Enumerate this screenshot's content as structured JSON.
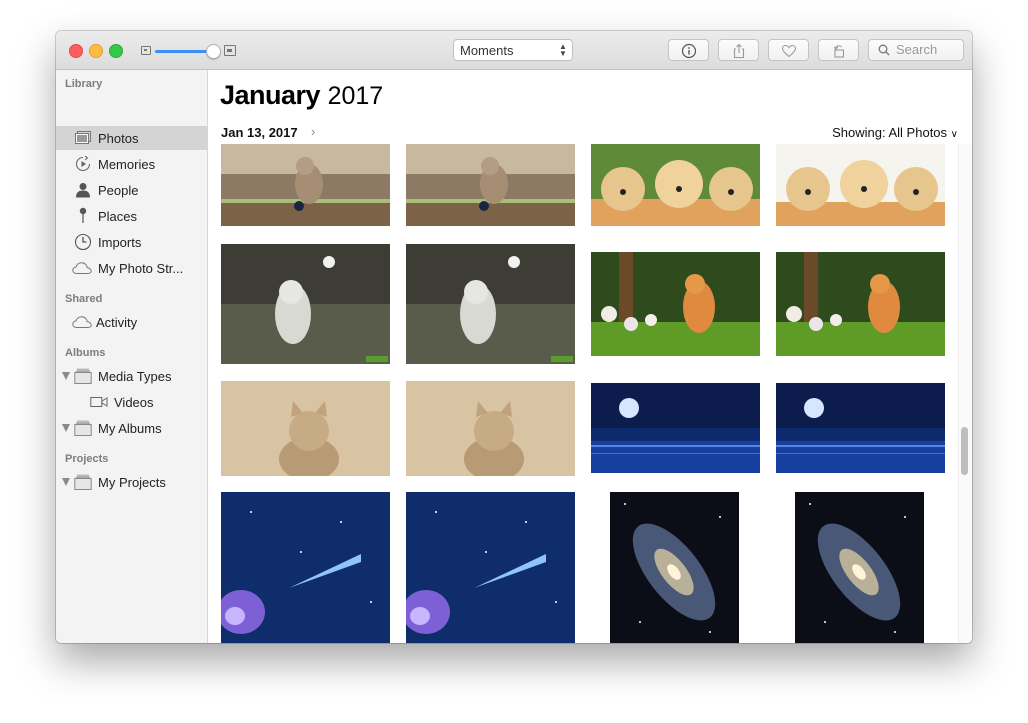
{
  "toolbar": {
    "view_select": "Moments",
    "search_placeholder": "Search"
  },
  "sidebar": {
    "sections": [
      {
        "title": "Library"
      },
      {
        "title": "Shared"
      },
      {
        "title": "Albums"
      },
      {
        "title": "Projects"
      }
    ],
    "items": [
      {
        "label": "Photos",
        "icon": "photos-icon",
        "selected": true
      },
      {
        "label": "Memories",
        "icon": "memories-icon"
      },
      {
        "label": "People",
        "icon": "people-icon"
      },
      {
        "label": "Places",
        "icon": "places-pin-icon"
      },
      {
        "label": "Imports",
        "icon": "imports-clock-icon"
      },
      {
        "label": "My Photo Str...",
        "icon": "cloud-icon"
      },
      {
        "label": "Activity",
        "icon": "cloud-icon"
      },
      {
        "label": "Media Types",
        "icon": "folder-icon"
      },
      {
        "label": "Videos",
        "icon": "video-camera-icon"
      },
      {
        "label": "My Albums",
        "icon": "folder-icon"
      },
      {
        "label": "My Projects",
        "icon": "folder-icon"
      }
    ]
  },
  "main": {
    "month": "January",
    "year": "2017",
    "date": "Jan 13, 2017",
    "showing_label": "Showing:",
    "showing_value": "All Photos",
    "photos": [
      {
        "subject": "kitten-playing-ball"
      },
      {
        "subject": "kitten-playing-ball"
      },
      {
        "subject": "three-puppies"
      },
      {
        "subject": "three-puppies"
      },
      {
        "subject": "dog-looking-at-butterfly"
      },
      {
        "subject": "dog-looking-at-butterfly"
      },
      {
        "subject": "orange-kitten-flowers"
      },
      {
        "subject": "orange-kitten-flowers"
      },
      {
        "subject": "kitten-sepia"
      },
      {
        "subject": "kitten-sepia"
      },
      {
        "subject": "moon-over-sea"
      },
      {
        "subject": "moon-over-sea"
      },
      {
        "subject": "comet-space"
      },
      {
        "subject": "comet-space"
      },
      {
        "subject": "andromeda-galaxy"
      },
      {
        "subject": "andromeda-galaxy"
      }
    ]
  },
  "colors": {
    "accent": "#3c8ef5",
    "sidebar_bg": "#f3f3f3",
    "selection": "#d4d4d4"
  }
}
